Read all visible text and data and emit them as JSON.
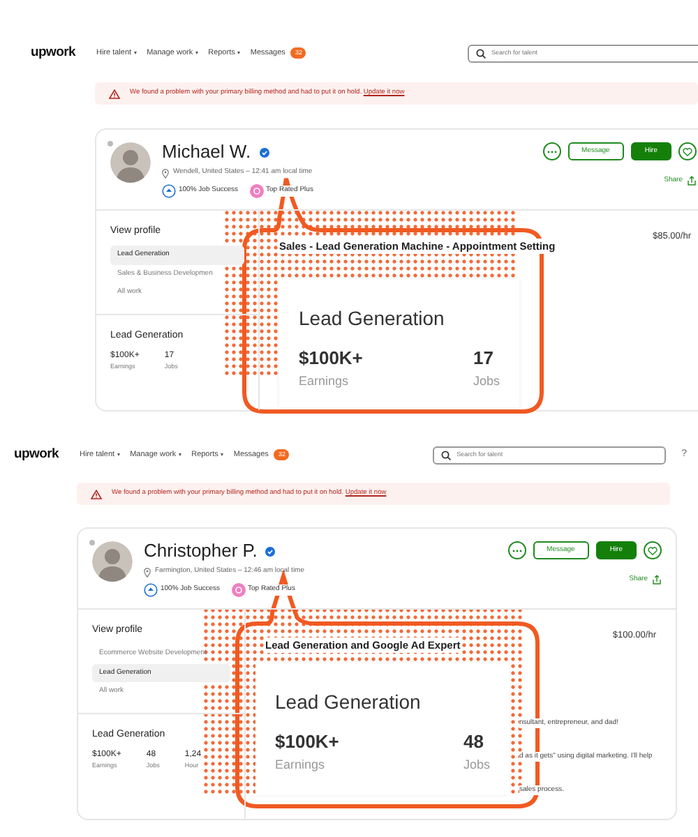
{
  "screens": [
    {
      "nav": {
        "logo": "upwork",
        "items": [
          {
            "label": "Hire talent"
          },
          {
            "label": "Manage work"
          },
          {
            "label": "Reports"
          }
        ],
        "messages": {
          "label": "Messages",
          "badge": "32"
        },
        "search": {
          "placeholder": "Search for talent"
        }
      },
      "alert": {
        "text": "We found a problem with your primary billing method and had to put it on hold.",
        "link": "Update it now"
      },
      "profile": {
        "name": "Michael W.",
        "verified": true,
        "location": "Wendell, United States – 12:41 am local time",
        "badges": [
          {
            "label": "100% Job Success",
            "kind": "success"
          },
          {
            "label": "Top Rated Plus",
            "kind": "rated"
          }
        ],
        "buttons": [
          "Message",
          "Hire"
        ],
        "share": "Share"
      },
      "sidebar": {
        "title": "View profile",
        "items": [
          {
            "label": "Lead Generation",
            "selected": true
          },
          {
            "label": "Sales & Business Developmen",
            "selected": false
          },
          {
            "label": "All work",
            "selected": false
          }
        ]
      },
      "stats": {
        "title": "Lead Generation",
        "items": [
          {
            "value": "$100K+",
            "label": "Earnings"
          },
          {
            "value": "17",
            "label": "Jobs"
          }
        ]
      },
      "job": {
        "title": "Sales - Lead Generation Machine - Appointment Setting",
        "rate": "$85.00/hr"
      },
      "callout": {
        "title": "Lead Generation",
        "stats": [
          {
            "value": "$100K+",
            "label": "Earnings"
          },
          {
            "value": "17",
            "label": "Jobs"
          }
        ]
      }
    },
    {
      "nav": {
        "logo": "upwork",
        "items": [
          {
            "label": "Hire talent"
          },
          {
            "label": "Manage work"
          },
          {
            "label": "Reports"
          }
        ],
        "messages": {
          "label": "Messages",
          "badge": "32"
        },
        "search": {
          "placeholder": "Search for talent"
        },
        "help": "?"
      },
      "alert": {
        "text": "We found a problem with your primary billing method and had to put it on hold.",
        "link": "Update it now"
      },
      "profile": {
        "name": "Christopher P.",
        "verified": true,
        "location": "Farmington, United States – 12:46 am local time",
        "badges": [
          {
            "label": "100% Job Success",
            "kind": "success"
          },
          {
            "label": "Top Rated Plus",
            "kind": "rated"
          }
        ],
        "buttons": [
          "Message",
          "Hire"
        ],
        "share": "Share"
      },
      "sidebar": {
        "title": "View profile",
        "items": [
          {
            "label": "Ecommerce Website Development",
            "selected": false
          },
          {
            "label": "Lead Generation",
            "selected": true
          },
          {
            "label": "All work",
            "selected": false
          }
        ]
      },
      "stats": {
        "title": "Lead Generation",
        "items": [
          {
            "value": "$100K+",
            "label": "Earnings"
          },
          {
            "value": "48",
            "label": "Jobs"
          },
          {
            "value": "1,24",
            "label": "Hour"
          }
        ]
      },
      "job": {
        "title": "Lead Generation and Google Ad Expert",
        "rate": "$100.00/hr",
        "description": [
          "nsultant, entrepreneur, and dad!",
          "d as it gets\" using digital marketing. I'll help",
          "sales process."
        ]
      },
      "callout": {
        "title": "Lead Generation",
        "stats": [
          {
            "value": "$100K+",
            "label": "Earnings"
          },
          {
            "value": "48",
            "label": "Jobs"
          }
        ]
      }
    }
  ]
}
